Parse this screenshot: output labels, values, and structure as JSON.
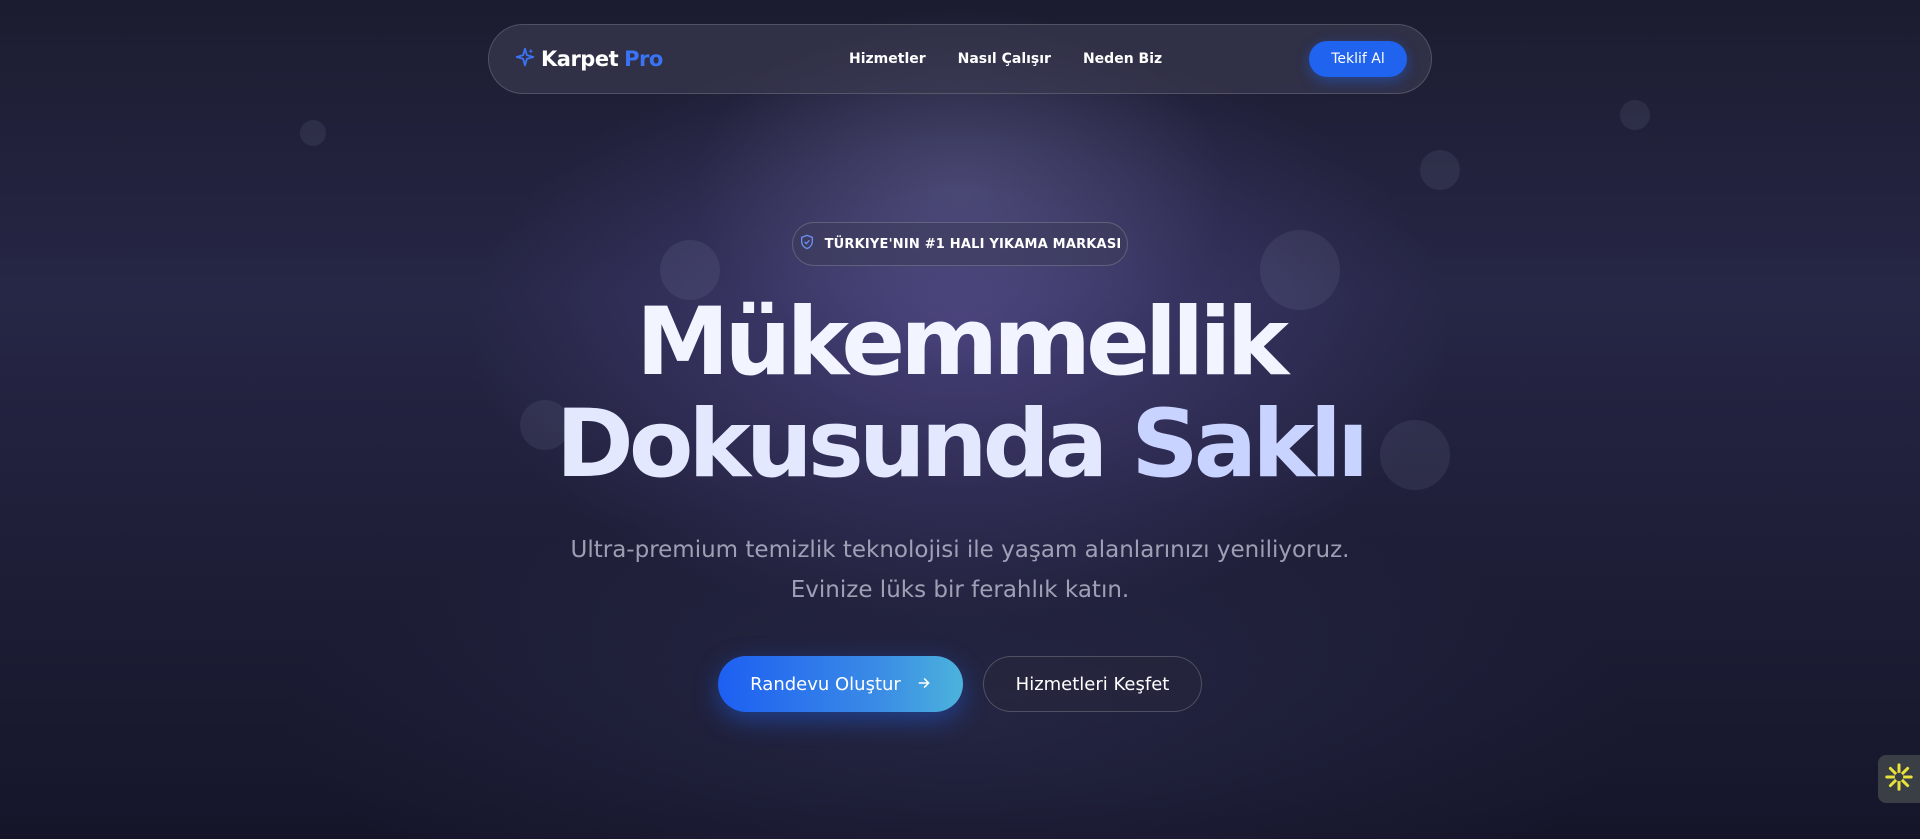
{
  "brand": {
    "name_part1": "Karpet",
    "name_part2": "Pro",
    "accent_color": "#3a73f5"
  },
  "nav": {
    "links": [
      "Hizmetler",
      "Nasıl Çalışır",
      "Neden Biz"
    ],
    "cta_label": "Teklif Al"
  },
  "hero": {
    "badge": "TÜRKIYE'NIN #1 HALI YIKAMA MARKASI",
    "headline_line1": "Mükemmellik",
    "headline_line2_a": "Dokusunda",
    "headline_line2_b": "Saklı",
    "subtitle_line1": "Ultra-premium temizlik teknolojisi ile yaşam alanlarınızı yeniliyoruz.",
    "subtitle_line2": "Evinize lüks bir ferahlık katın.",
    "primary_button": "Randevu Oluştur",
    "secondary_button": "Hizmetleri Keşfet"
  },
  "icons": {
    "logo": "sparkle-icon",
    "badge": "shield-check-icon",
    "primary_button": "arrow-right-icon",
    "widget": "asterisk-flower-icon"
  },
  "colors": {
    "primary": "#1f63ef",
    "gradient_end": "#4cb3dc",
    "widget_yellow": "#e8e23a"
  }
}
